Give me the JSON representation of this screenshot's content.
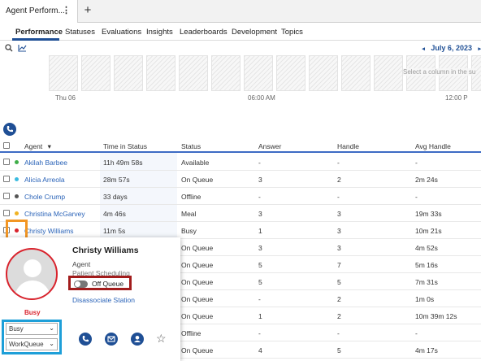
{
  "tab": {
    "title": "Agent Perform...",
    "menu_icon": "kebab-icon",
    "add_label": "+"
  },
  "subnav": {
    "items": [
      "Performance",
      "Statuses",
      "Evaluations",
      "Insights",
      "Leaderboards",
      "Development",
      "Topics"
    ]
  },
  "toolbar": {
    "search_icon": "search-icon",
    "chart_icon": "chart-icon"
  },
  "datebar": {
    "prev": "◂",
    "date": "July 6, 2023",
    "next": "▸"
  },
  "timeline": {
    "hint": "Select a column in the su",
    "labels": [
      "Thu 06",
      "06:00 AM",
      "12:00 P"
    ]
  },
  "columns": [
    "Agent",
    "Time in Status",
    "Status",
    "Answer",
    "Handle",
    "Avg Handle"
  ],
  "sort_indicator": "▾",
  "rows": [
    {
      "name": "Akilah Barbee",
      "dot": "#3fae49",
      "time": "11h 49m 58s",
      "status": "Available",
      "answer": "-",
      "handle": "-",
      "avg": "-"
    },
    {
      "name": "Alicia Arreola",
      "dot": "#3bbbe0",
      "time": "28m 57s",
      "status": "On Queue",
      "answer": "3",
      "handle": "2",
      "avg": "2m 24s"
    },
    {
      "name": "Chole Crump",
      "dot": "#555555",
      "time": "33 days",
      "status": "Offline",
      "answer": "-",
      "handle": "-",
      "avg": "-"
    },
    {
      "name": "Christina McGarvey",
      "dot": "#f0b323",
      "time": "4m 46s",
      "status": "Meal",
      "answer": "3",
      "handle": "3",
      "avg": "19m 33s"
    },
    {
      "name": "Christy Williams",
      "dot": "#d9232d",
      "time": "11m 5s",
      "status": "Busy",
      "answer": "1",
      "handle": "3",
      "avg": "10m 21s"
    },
    {
      "name": "",
      "dot": "",
      "time": "",
      "status": "On Queue",
      "answer": "3",
      "handle": "3",
      "avg": "4m 52s"
    },
    {
      "name": "",
      "dot": "",
      "time": "",
      "status": "On Queue",
      "answer": "5",
      "handle": "7",
      "avg": "5m 16s"
    },
    {
      "name": "",
      "dot": "",
      "time": "",
      "status": "On Queue",
      "answer": "5",
      "handle": "5",
      "avg": "7m 31s"
    },
    {
      "name": "",
      "dot": "",
      "time": "",
      "status": "On Queue",
      "answer": "-",
      "handle": "2",
      "avg": "1m 0s"
    },
    {
      "name": "",
      "dot": "",
      "time": "",
      "status": "On Queue",
      "answer": "1",
      "handle": "2",
      "avg": "10m 39m 12s"
    },
    {
      "name": "",
      "dot": "",
      "time": "",
      "status": "Offline",
      "answer": "-",
      "handle": "-",
      "avg": "-"
    },
    {
      "name": "",
      "dot": "",
      "time": "",
      "status": "On Queue",
      "answer": "4",
      "handle": "5",
      "avg": "4m 17s"
    }
  ],
  "card": {
    "name": "Christy Williams",
    "role": "Agent",
    "division": "Patient Scheduling",
    "presence_label": "Busy",
    "queue_toggle": "Off Queue",
    "disassociate": "Disassociate Station",
    "status_select": "Busy",
    "queue_select": "WorkQueue",
    "action_icons": [
      "phone-icon",
      "email-icon",
      "profile-icon",
      "star-icon"
    ]
  },
  "colors": {
    "accent": "#1f4f95",
    "link": "#2a63b8",
    "busy": "#d9232d",
    "highlight_orange": "#f29624",
    "highlight_blue": "#1e9fd8",
    "highlight_red": "#a21c1c"
  }
}
